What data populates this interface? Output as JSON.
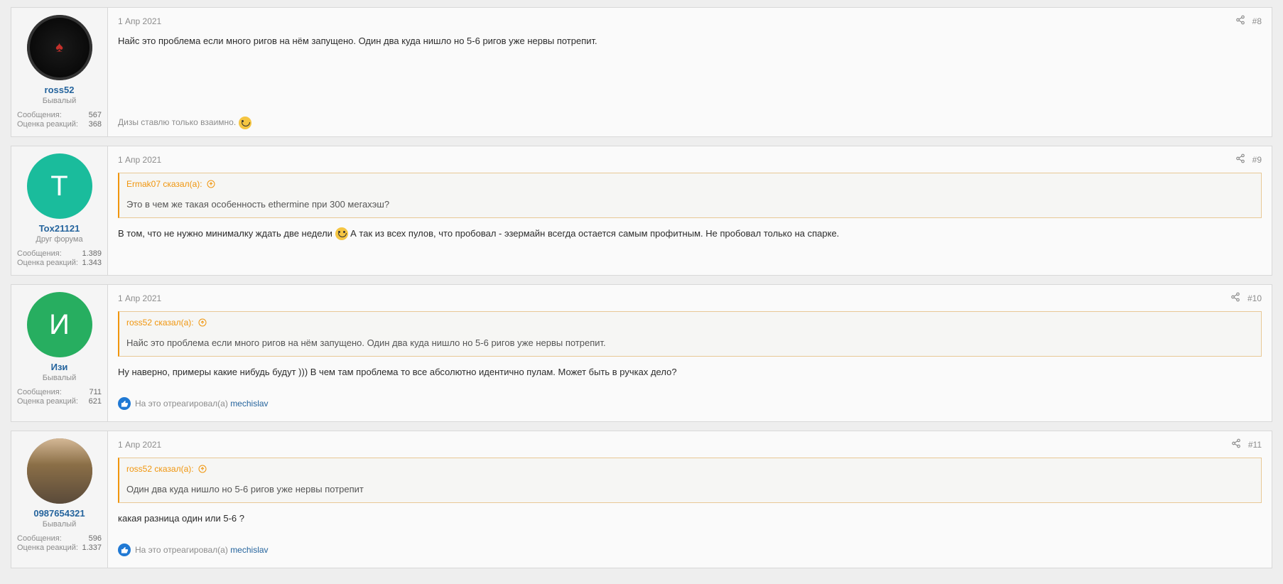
{
  "posts": [
    {
      "date": "1 Апр 2021",
      "postnum": "#8",
      "user": {
        "name": "ross52",
        "title": "Бывалый",
        "avatar_type": "poker",
        "stats": [
          {
            "label": "Сообщения:",
            "value": "567"
          },
          {
            "label": "Оценка реакций:",
            "value": "368"
          }
        ]
      },
      "body": "Найс это проблема если много ригов на нём запущено. Один два куда нишло но 5-6 ригов уже нервы потрепит.",
      "signature": "Дизы ставлю только взаимно."
    },
    {
      "date": "1 Апр 2021",
      "postnum": "#9",
      "user": {
        "name": "Tox21121",
        "title": "Друг форума",
        "avatar_type": "teal",
        "avatar_letter": "T",
        "stats": [
          {
            "label": "Сообщения:",
            "value": "1.389"
          },
          {
            "label": "Оценка реакций:",
            "value": "1.343"
          }
        ]
      },
      "quote": {
        "author": "Ermak07 сказал(а):",
        "text": "Это в чем же такая особенность ethermine при 300 мегахэш?"
      },
      "body_before": "В том, что не нужно минималку ждать две недели ",
      "body_after": " А так из всех пулов, что пробовал - эзермайн всегда остается самым профитным. Не пробовал только на спарке."
    },
    {
      "date": "1 Апр 2021",
      "postnum": "#10",
      "user": {
        "name": "Изи",
        "title": "Бывалый",
        "avatar_type": "green",
        "avatar_letter": "И",
        "stats": [
          {
            "label": "Сообщения:",
            "value": "711"
          },
          {
            "label": "Оценка реакций:",
            "value": "621"
          }
        ]
      },
      "quote": {
        "author": "ross52 сказал(а):",
        "text": "Найс это проблема если много ригов на нём запущено. Один два куда нишло но 5-6 ригов уже нервы потрепит."
      },
      "body": "Ну наверно, примеры какие нибудь будут ))) В чем там проблема то все абсолютно идентично пулам. Может быть в ручках дело?",
      "reactions": {
        "prefix": "На это отреагировал(а)",
        "name": "mechislav"
      }
    },
    {
      "date": "1 Апр 2021",
      "postnum": "#11",
      "user": {
        "name": "0987654321",
        "title": "Бывалый",
        "avatar_type": "photo",
        "stats": [
          {
            "label": "Сообщения:",
            "value": "596"
          },
          {
            "label": "Оценка реакций:",
            "value": "1.337"
          }
        ]
      },
      "quote": {
        "author": "ross52 сказал(а):",
        "text": "Один два куда нишло но 5-6 ригов уже нервы потрепит"
      },
      "body": "какая разница один или 5-6 ?",
      "reactions": {
        "prefix": "На это отреагировал(а)",
        "name": "mechislav"
      }
    }
  ]
}
